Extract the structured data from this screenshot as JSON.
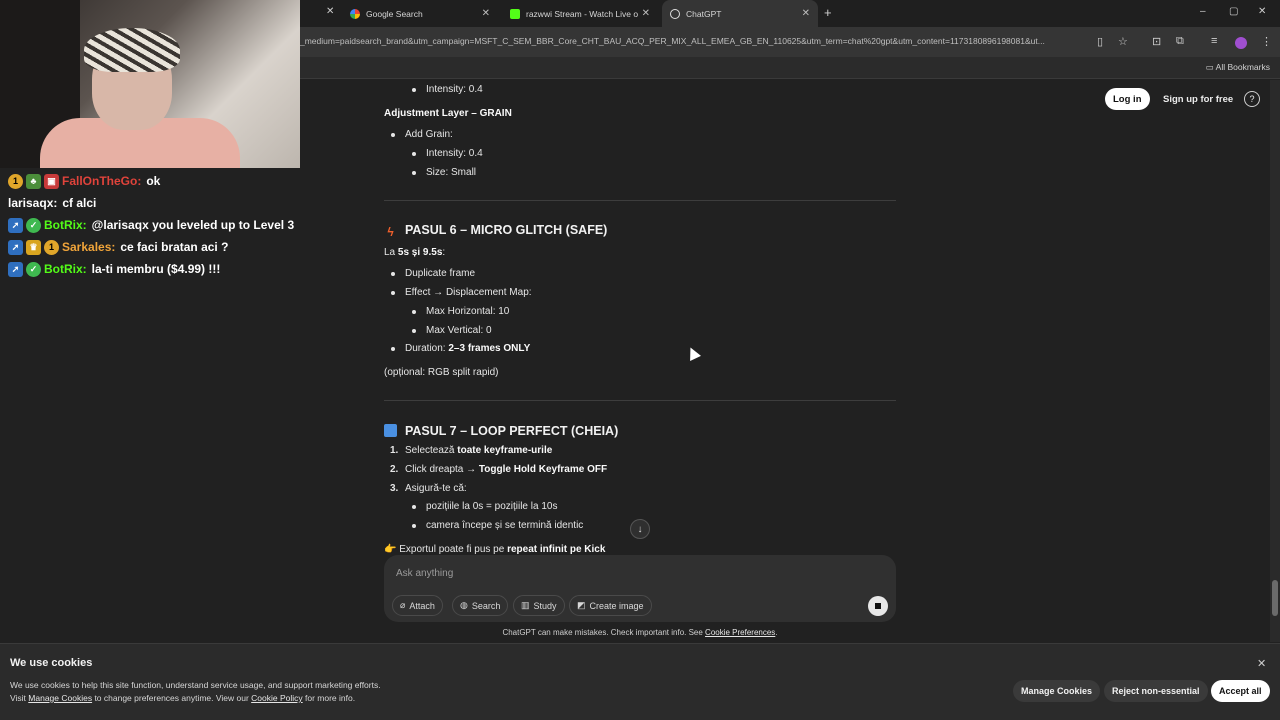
{
  "browser": {
    "tabs": [
      {
        "title": "Google Search"
      },
      {
        "title": "razwwi Stream - Watch Live on Kick"
      },
      {
        "title": "ChatGPT"
      }
    ],
    "new_tab_icon": "+",
    "url": "_medium=paidsearch_brand&utm_campaign=MSFT_C_SEM_BBR_Core_CHT_BAU_ACQ_PER_MIX_ALL_EMEA_GB_EN_110625&utm_term=chat%20gpt&utm_content=1173180896198081&ut...",
    "all_bookmarks": "All Bookmarks"
  },
  "stream_chat": [
    {
      "user": "FallOnTheGo:",
      "message": "ok",
      "user_color": "#e0433b"
    },
    {
      "user": "larisaqx:",
      "message": "cf alci",
      "user_color": "#ffffff"
    },
    {
      "user": "BotRix:",
      "message": "@larisaqx you leveled up to Level 3",
      "user_color": "#53fc18"
    },
    {
      "user": "Sarkales:",
      "message": "ce faci bratan aci ?",
      "user_color": "#f0a43a"
    },
    {
      "user": "BotRix:",
      "message": "la-ti membru ($4.99) !!!",
      "user_color": "#53fc18"
    }
  ],
  "header": {
    "login": "Log in",
    "signup": "Sign up for free",
    "help": "?"
  },
  "content": {
    "intensity_top": "Intensity: 0.4",
    "grain_heading": "Adjustment Layer – GRAIN",
    "add_grain": "Add Grain:",
    "grain_intensity": "Intensity: 0.4",
    "grain_size": "Size: Small",
    "step6_title": "PASUL 6 – MICRO GLITCH (SAFE)",
    "step6_la": "La ",
    "step6_time": "5s și 9.5s",
    "step6_colon": ":",
    "duplicate": "Duplicate frame",
    "effect": "Effect → Displacement Map:",
    "max_h": "Max Horizontal: 10",
    "max_v": "Max Vertical: 0",
    "duration_label": "Duration: ",
    "duration_value": "2–3 frames ONLY",
    "optional": "(opțional: RGB split rapid)",
    "step7_title": "PASUL 7 – LOOP PERFECT (CHEIA)",
    "n1": "1.",
    "n2": "2.",
    "n3": "3.",
    "s1_a": "Selectează ",
    "s1_b": "toate keyframe-urile",
    "s2_a": "Click dreapta → ",
    "s2_b": "Toggle Hold Keyframe OFF",
    "s3": "Asigură-te că:",
    "s3_a": "pozițiile la 0s = pozițiile la 10s",
    "s3_b": "camera începe și se termină identic",
    "export_a": "👉 Exportul poate fi pus pe ",
    "export_b": "repeat infinit pe Kick"
  },
  "composer": {
    "placeholder": "Ask anything",
    "attach": "Attach",
    "search": "Search",
    "study": "Study",
    "create_image": "Create image"
  },
  "disclaimer": {
    "text": "ChatGPT can make mistakes. Check important info. See ",
    "link": "Cookie Preferences",
    "end": "."
  },
  "cookies": {
    "title": "We use cookies",
    "line1": "We use cookies to help this site function, understand service usage, and support marketing efforts.",
    "line2_a": "Visit ",
    "line2_link1": "Manage Cookies",
    "line2_b": " to change preferences anytime. View our ",
    "line2_link2": "Cookie Policy",
    "line2_c": " for more info.",
    "manage": "Manage Cookies",
    "reject": "Reject non-essential",
    "accept": "Accept all",
    "close": "✕"
  },
  "colors": {
    "background": "#212121",
    "kick_green": "#53fc18",
    "step6_icon": "#f0602c",
    "step7_icon": "#4a90e2"
  }
}
